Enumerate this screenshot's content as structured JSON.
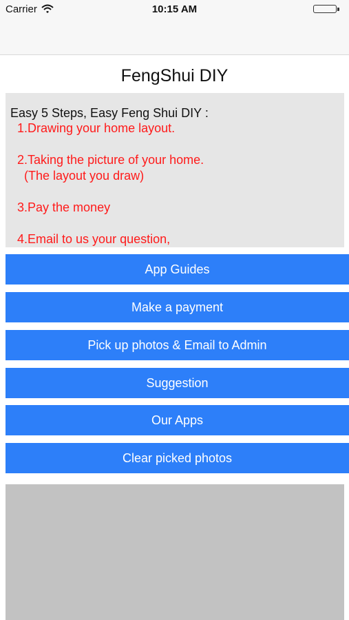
{
  "status_bar": {
    "carrier": "Carrier",
    "time": "10:15 AM",
    "battery_color": "#4cd964"
  },
  "title": "FengShui DIY",
  "info": {
    "heading": "Easy 5 Steps, Easy Feng Shui DIY :",
    "step1": "1.Drawing your home layout.",
    "step2": "2.Taking the picture of your home.",
    "step2_note": "(The layout you draw)",
    "step3": "3.Pay the money",
    "step4": "4.Email to us your question,"
  },
  "buttons": {
    "app_guides": "App Guides",
    "make_payment": "Make a payment",
    "pick_photos": "Pick up photos & Email to Admin",
    "suggestion": "Suggestion",
    "our_apps": "Our Apps",
    "clear_photos": "Clear picked photos"
  },
  "colors": {
    "button": "#2d7ff9",
    "step_text": "#ff1a1a",
    "info_bg": "#e6e6e6",
    "photo_bg": "#c2c2c2"
  }
}
